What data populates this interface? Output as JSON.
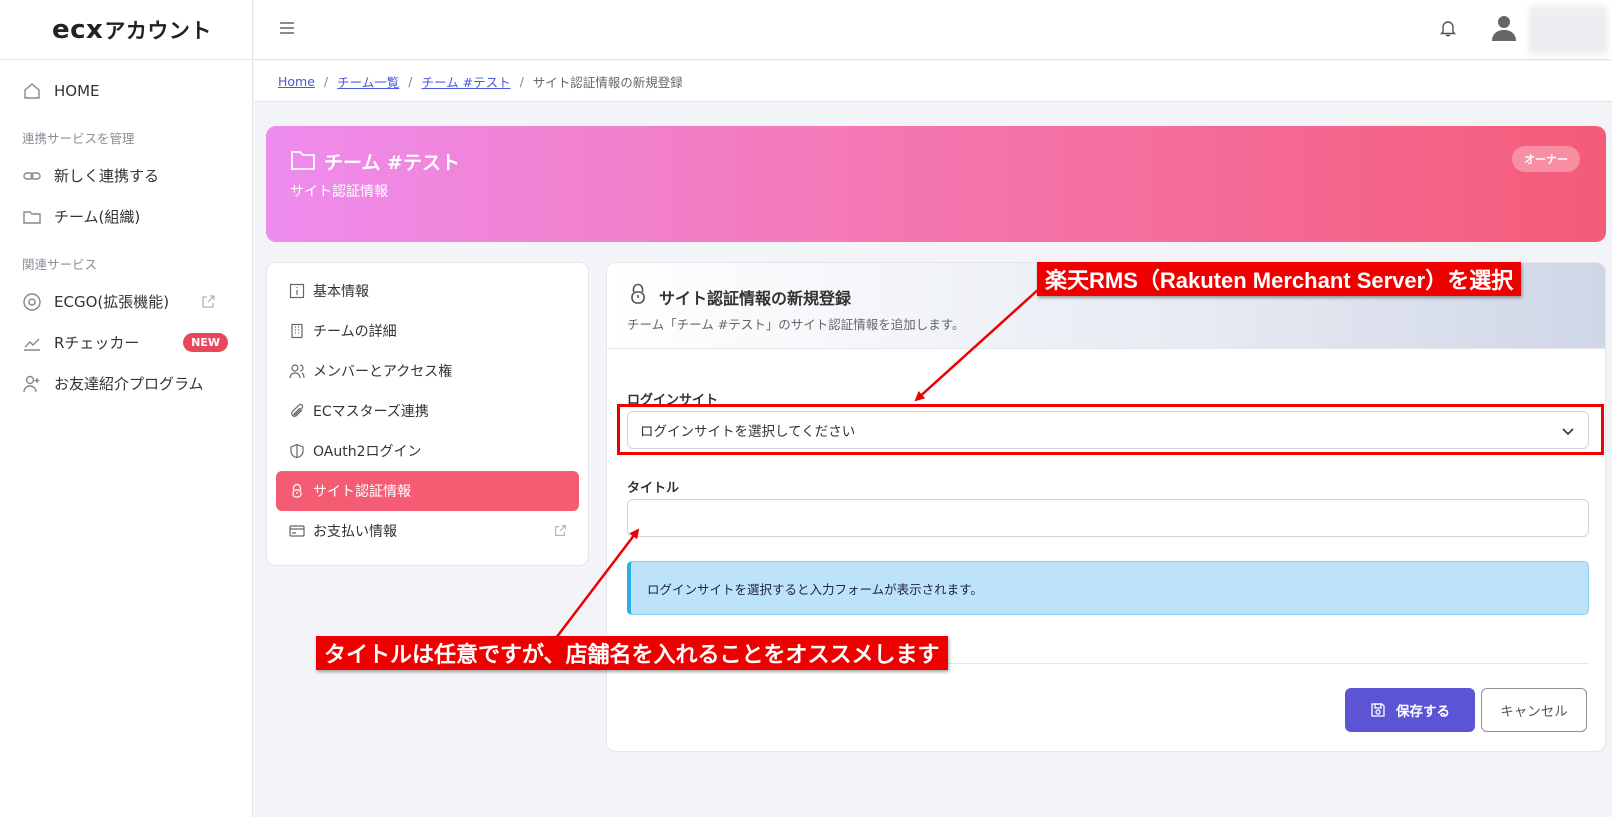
{
  "app": {
    "logo_ecx": "ecx",
    "logo_rest": "アカウント"
  },
  "sidebar": {
    "home": "HOME",
    "section_manage": "連携サービスを管理",
    "new_link": "新しく連携する",
    "team": "チーム(組織)",
    "section_related": "関連サービス",
    "ecgo": "ECGO(拡張機能)",
    "rchecker": "Rチェッカー",
    "new_badge": "NEW",
    "referral": "お友達紹介プログラム"
  },
  "breadcrumb": {
    "home": "Home",
    "team_list": "チーム一覧",
    "team": "チーム #テスト",
    "current": "サイト認証情報の新規登録",
    "sep": "/"
  },
  "banner": {
    "title": "チーム #テスト",
    "subtitle": "サイト認証情報",
    "role": "オーナー"
  },
  "menu": {
    "items": [
      {
        "label": "基本情報"
      },
      {
        "label": "チームの詳細"
      },
      {
        "label": "メンバーとアクセス権"
      },
      {
        "label": "ECマスターズ連携"
      },
      {
        "label": "OAuth2ログイン"
      },
      {
        "label": "サイト認証情報"
      },
      {
        "label": "お支払い情報"
      }
    ]
  },
  "form": {
    "heading": "サイト認証情報の新規登録",
    "description": "チーム「チーム #テスト」のサイト認証情報を追加します。",
    "login_site_label": "ログインサイト",
    "login_site_value": "ログインサイトを選択してください",
    "title_label": "タイトル",
    "title_value": "",
    "info": "ログインサイトを選択すると入力フォームが表示されます。",
    "save": "保存する",
    "cancel": "キャンセル"
  },
  "annotations": {
    "select_note": "楽天RMS（Rakuten Merchant Server）を選択",
    "title_note": "タイトルは任意ですが、店舗名を入れることをオススメします"
  },
  "colors": {
    "accent": "#5b55d6",
    "active_menu": "#f45c74",
    "annotation": "#ee0000",
    "info_bg": "#bde3fb"
  }
}
